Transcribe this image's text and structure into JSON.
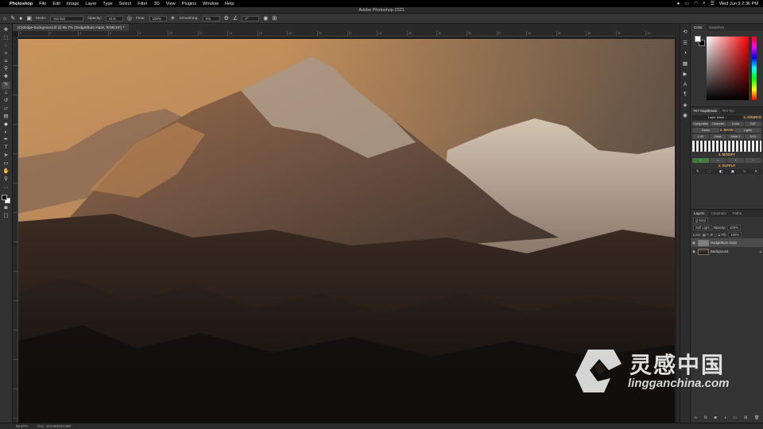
{
  "menubar": {
    "app_name": "Photoshop",
    "items": [
      "File",
      "Edit",
      "Image",
      "Layer",
      "Type",
      "Select",
      "Filter",
      "3D",
      "View",
      "Plugins",
      "Window",
      "Help"
    ],
    "datetime": "Wed Jun 9  2:36 PM"
  },
  "window": {
    "title": "Adobe Photoshop 2021"
  },
  "options": {
    "mode_label": "Mode:",
    "mode_value": "Normal",
    "opacity_label": "Opacity:",
    "opacity_value": "41%",
    "flow_label": "Flow:",
    "flow_value": "100%",
    "smoothing_label": "Smoothing:",
    "smoothing_value": "0%",
    "angle_value": "0°"
  },
  "document": {
    "tab_title": "(C)dodge-background.tif @ 66.7% (Dodge/Burn Haze, RGB/16*) *",
    "ruler_ticks": [
      "0",
      "2",
      "4",
      "6",
      "8",
      "10",
      "12",
      "14",
      "16",
      "18",
      "20",
      "22",
      "24",
      "26",
      "28",
      "30",
      "32",
      "34",
      "36",
      "38",
      "40",
      "42"
    ]
  },
  "status": {
    "zoom": "66.67%",
    "doc_size": "Doc: 413.9M/413.9M"
  },
  "panels": {
    "color_tabs": [
      "Color",
      "Swatches"
    ],
    "rapid_tabs": [
      "TK7 RapidMask",
      "TK7 Go"
    ],
    "rapid": {
      "source_header": "1. SOURCE",
      "layer_mask_label": "Layer Mask ~",
      "source_buttons": [
        "Composite",
        "Channel",
        "Color",
        "SAT"
      ],
      "mask_header": "2. MASK",
      "mask_buttons": [
        "Darks",
        "Lights"
      ],
      "output_header": "3. OUTPUT",
      "zone_buttons": [
        "L-M",
        "Mids",
        "Mids-1",
        "M-D"
      ],
      "modify_header": "4. MODIFY"
    },
    "layers_tabs": [
      "Layers",
      "Channels",
      "Paths"
    ],
    "layers_kind": "Q Kind",
    "blend_mode": "Soft Light",
    "opacity_label": "Opacity:",
    "opacity_value": "100%",
    "lock_label": "Lock:",
    "fill_label": "Fill:",
    "fill_value": "100%",
    "layers": [
      {
        "name": "Dodge/Burn Haze"
      },
      {
        "name": "Background"
      }
    ]
  },
  "watermark": {
    "cn_text": "灵感中国",
    "url_text": "lingganchina.com"
  }
}
